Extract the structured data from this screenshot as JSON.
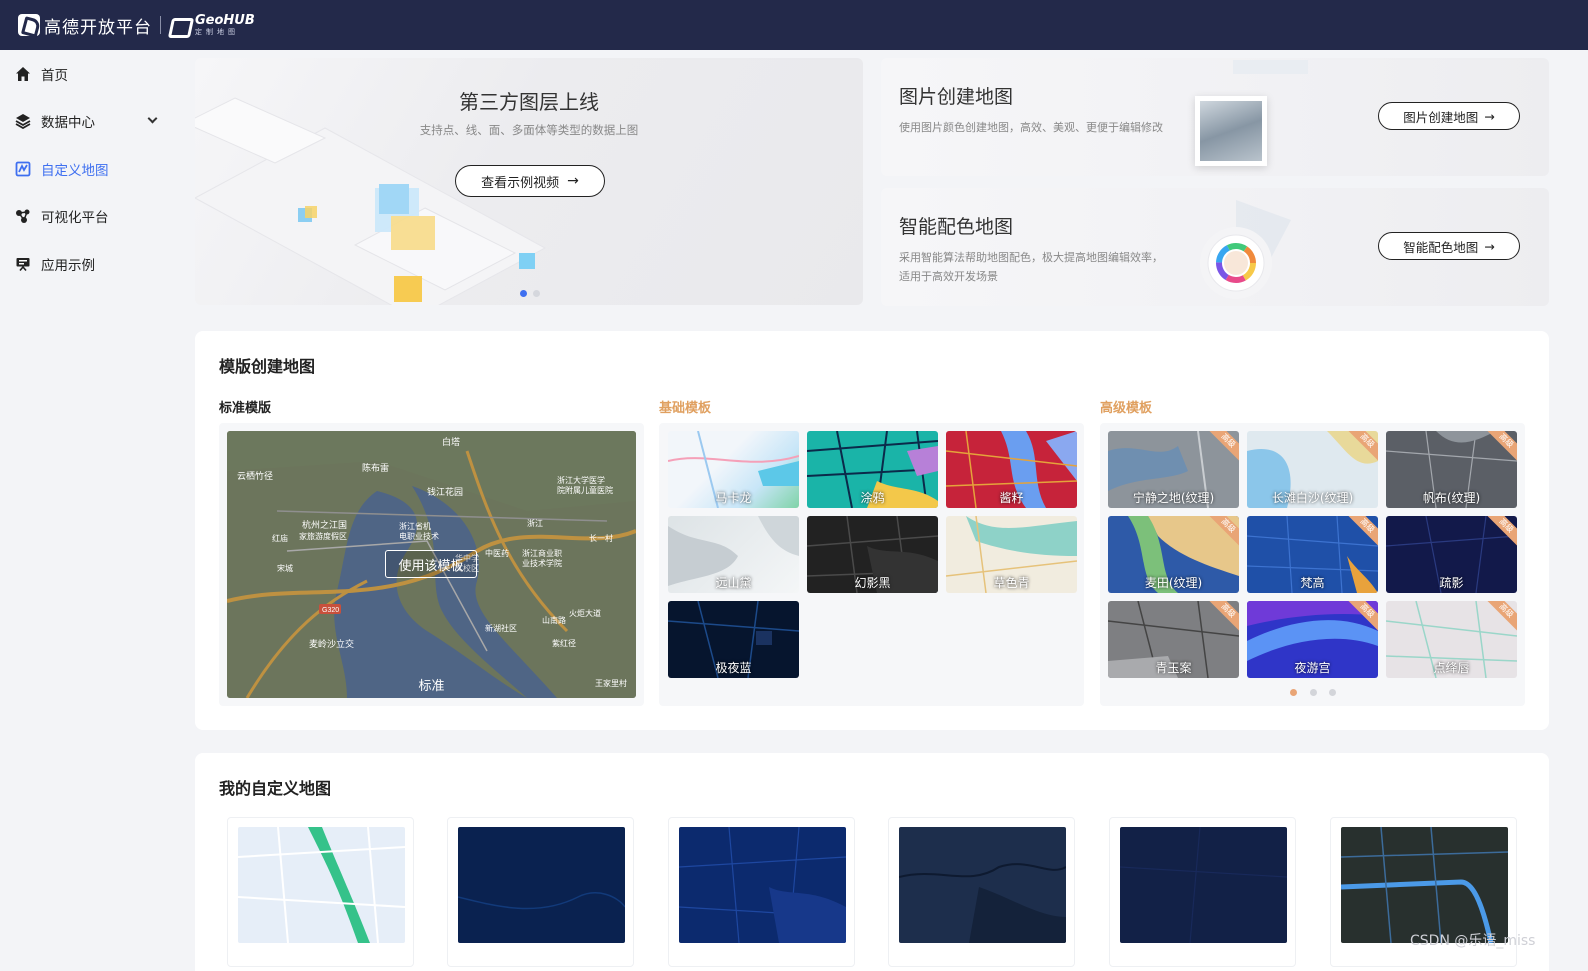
{
  "header": {
    "brand_name": "高德开放平台",
    "geohub_title": "GeoHUB",
    "geohub_sub": "定制地图"
  },
  "sidebar": {
    "items": [
      {
        "label": "首页",
        "icon": "home-icon"
      },
      {
        "label": "数据中心",
        "icon": "layers-icon"
      },
      {
        "label": "自定义地图",
        "icon": "custom-map-icon"
      },
      {
        "label": "可视化平台",
        "icon": "visualization-icon"
      },
      {
        "label": "应用示例",
        "icon": "app-example-icon"
      }
    ],
    "active_color": "#3e6ff0"
  },
  "hero": {
    "title": "第三方图层上线",
    "subtitle": "支持点、线、面、多面体等类型的数据上图",
    "button_label": "查看示例视频"
  },
  "promos": [
    {
      "title": "图片创建地图",
      "desc": "使用图片颜色创建地图，高效、美观、更便于编辑修改",
      "button_label": "图片创建地图"
    },
    {
      "title": "智能配色地图",
      "desc": "采用智能算法帮助地图配色，极大提高地图编辑效率，适用于高效开发场景",
      "button_label": "智能配色地图"
    }
  ],
  "template_section": {
    "title": "模版创建地图",
    "standard": {
      "title": "标准模版",
      "use_button": "使用该模板",
      "map_label": "标准",
      "place_labels": [
        "白塔",
        "陈布雷",
        "浙江大学医学",
        "院附属儿童医院",
        "云栖竹径",
        "钱江花园",
        "杭州之江国",
        "家旅游度假区",
        "浙江省机",
        "电职业技术",
        "中医药",
        "浙江商业职",
        "业技术学院",
        "红庙",
        "宋城",
        "麦岭沙立交",
        "浙江",
        "华中学",
        "文校区",
        "长一村",
        "新湖社区",
        "山南路",
        "紫红径",
        "火炬大道",
        "王家里村",
        "G320"
      ]
    },
    "basic": {
      "title": "基础模板",
      "title_color": "#e0a060",
      "items": [
        "马卡龙",
        "涂鸦",
        "酱籽",
        "远山黛",
        "幻影黑",
        "草色青",
        "极夜蓝"
      ]
    },
    "advanced": {
      "title": "高级模板",
      "title_color": "#e0a060",
      "ribbon": "高级",
      "items": [
        "宁静之地(纹理)",
        "长滩白沙(纹理)",
        "帆布(纹理)",
        "麦田(纹理)",
        "梵高",
        "疏影",
        "青玉案",
        "夜游宫",
        "点绛唇"
      ]
    }
  },
  "my_maps": {
    "title": "我的自定义地图"
  },
  "watermark": "CSDN @乐语_miss"
}
